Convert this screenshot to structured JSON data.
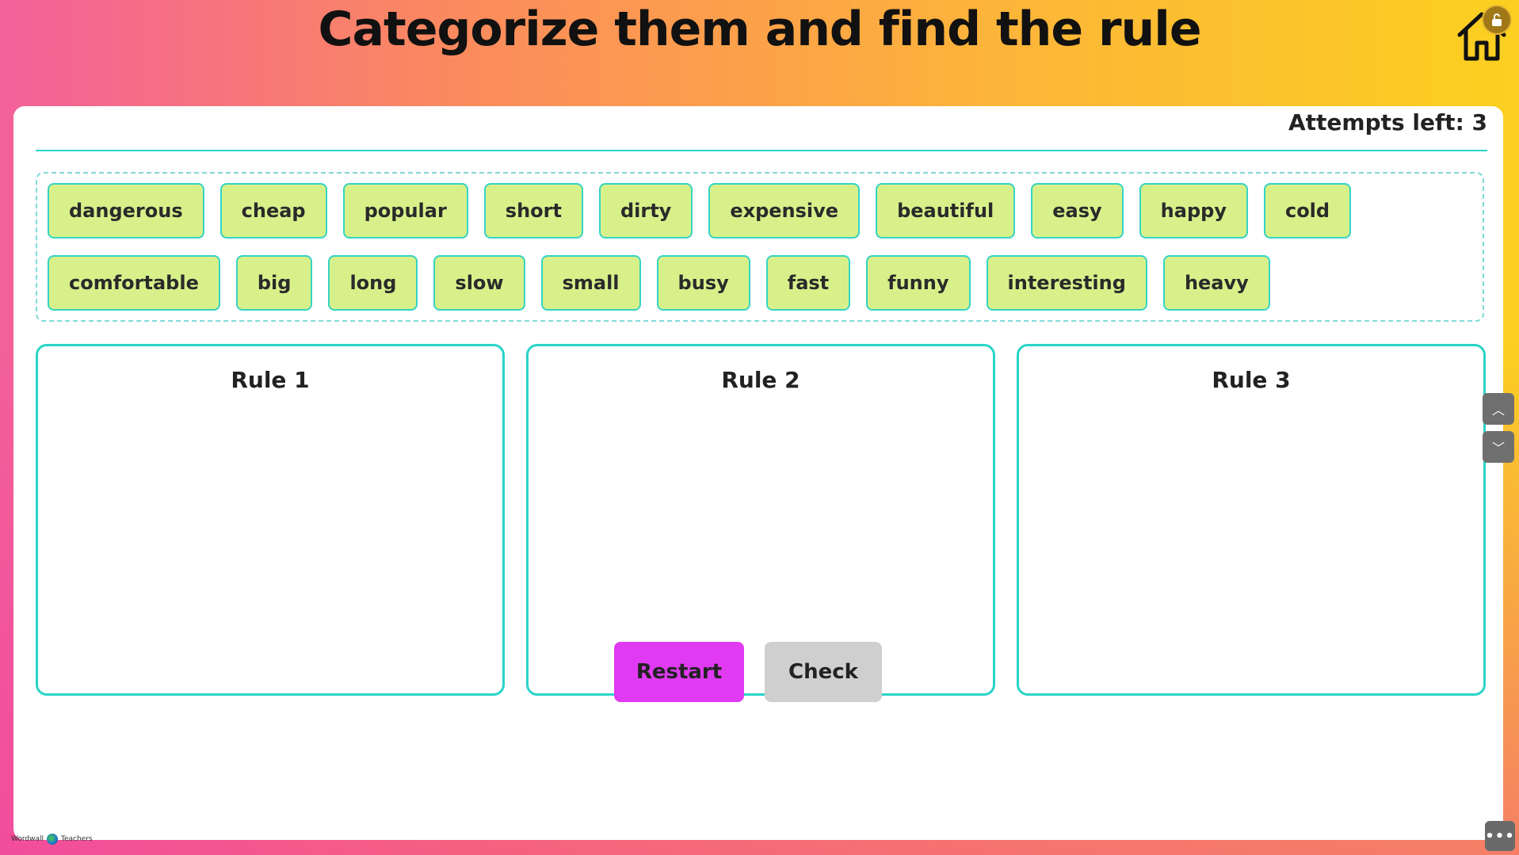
{
  "page": {
    "title": "Categorize them and find the rule"
  },
  "header": {
    "home_icon": "home-icon",
    "lock_icon": "lock-icon"
  },
  "game": {
    "attempts_label": "Attempts left: 3",
    "word_bank": {
      "row1": [
        "dangerous",
        "cheap",
        "popular",
        "short",
        "dirty",
        "expensive",
        "beautiful",
        "easy",
        "happy",
        "cold"
      ],
      "row2": [
        "comfortable",
        "big",
        "long",
        "slow",
        "small",
        "busy",
        "fast",
        "funny",
        "interesting",
        "heavy"
      ]
    },
    "rules": [
      "Rule 1",
      "Rule 2",
      "Rule 3"
    ],
    "buttons": {
      "restart": "Restart",
      "check": "Check"
    }
  },
  "controls": {
    "scroll_up_glyph": "︿",
    "scroll_down_glyph": "﹀",
    "menu_glyph": "•••"
  },
  "footer": {
    "brand_left": "Wordwall",
    "brand_right": "Teachers"
  },
  "colors": {
    "chip_fill": "#d8f08a",
    "accent_teal": "#2ad4c8",
    "restart_magenta": "#e03af2",
    "check_gray": "#cfcfcf"
  }
}
